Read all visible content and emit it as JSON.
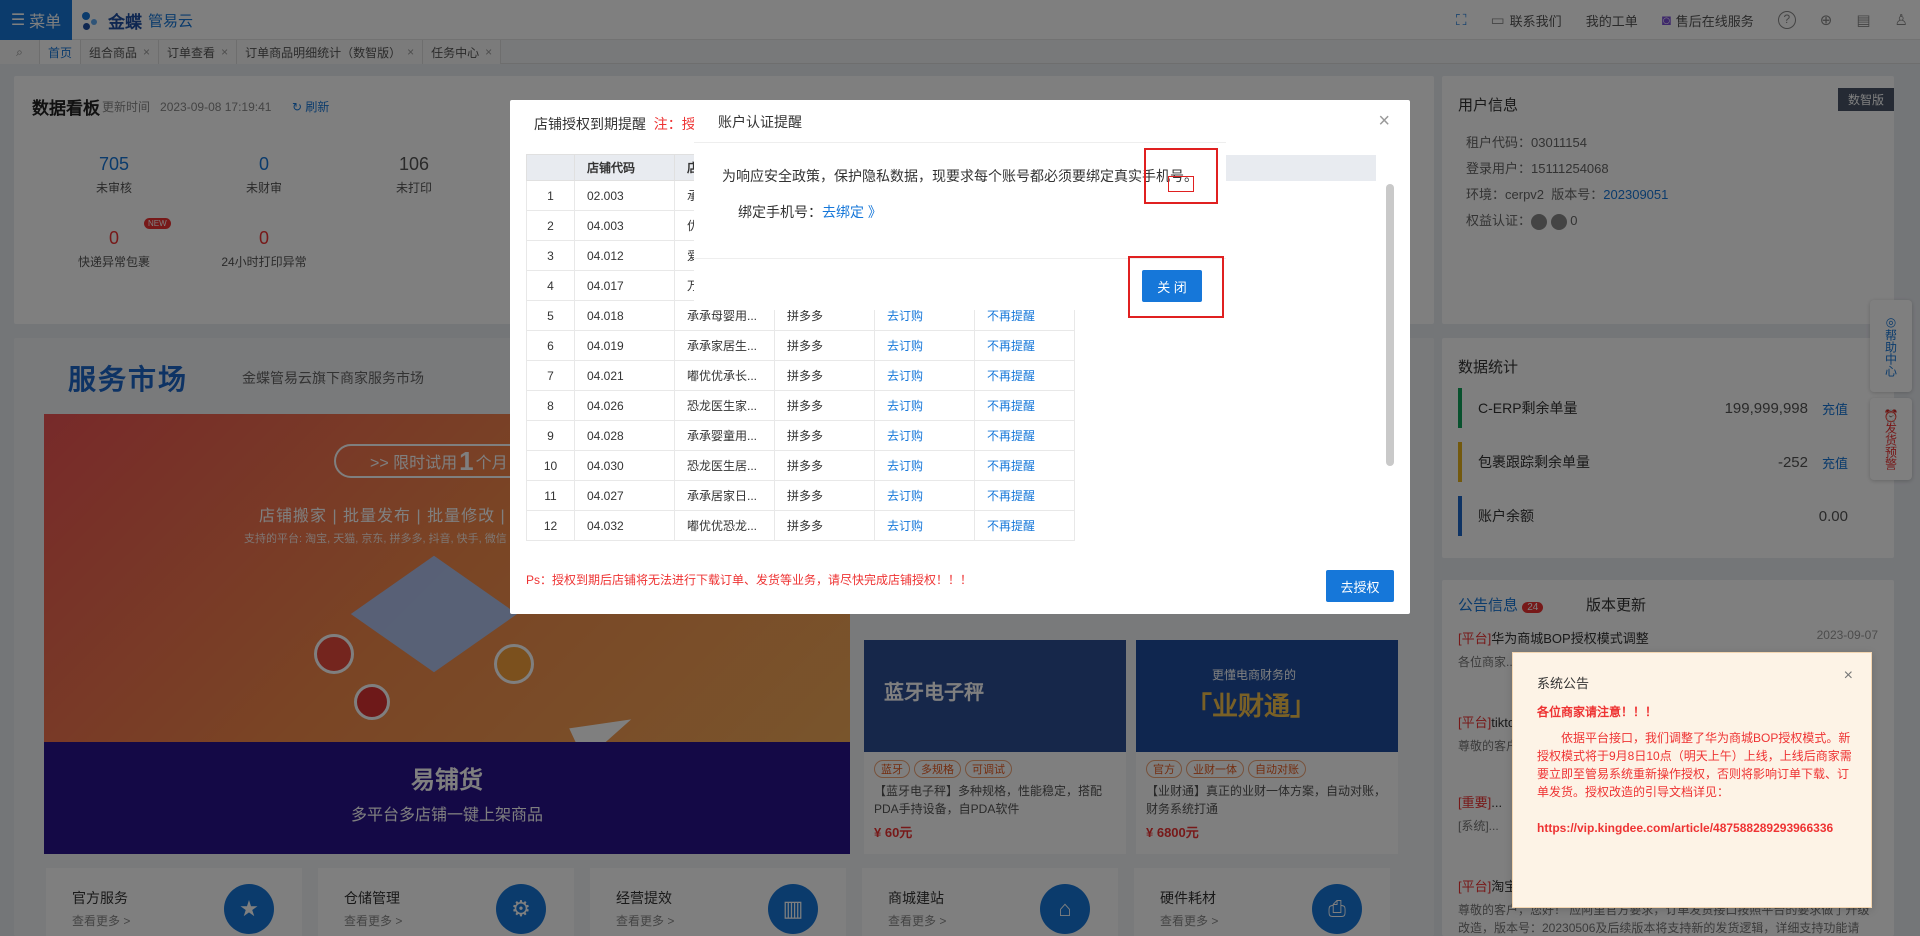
{
  "topbar": {
    "menu_label": "菜单",
    "brand_name": "金蝶",
    "brand_sub": "管易云",
    "links": [
      "联系我们",
      "我的工单",
      "售后在线服务"
    ]
  },
  "tabs": [
    {
      "label": "首页"
    },
    {
      "label": "组合商品"
    },
    {
      "label": "订单查看"
    },
    {
      "label": "订单商品明细统计（数智版）"
    },
    {
      "label": "任务中心"
    }
  ],
  "dashboard": {
    "title": "数据看板",
    "time_label": "更新时间",
    "time_value": "2023-09-08 17:19:41",
    "refresh": "刷新",
    "stats": [
      {
        "value": "705",
        "label": "未审核"
      },
      {
        "value": "0",
        "label": "未财审"
      },
      {
        "value": "106",
        "label": "未打印"
      },
      {
        "value": "0",
        "label": "快递异常包裹"
      },
      {
        "value": "0",
        "label": "24小时打印异常"
      }
    ],
    "new_tag": "NEW"
  },
  "service_market": {
    "title": "服务市场",
    "subtitle": "金蝶管易云旗下商家服务市场",
    "banner": {
      "pill": ">> 限时试用",
      "pill_big": "1",
      "pill_tail": "个月",
      "line": "店铺搬家 | 批量发布 | 批量修改 |",
      "small": "支持的平台: 淘宝, 天猫, 京东, 拼多多, 抖音, 快手, 微信",
      "title": "易铺货",
      "subtitle": "多平台多店铺一键上架商品"
    }
  },
  "products": [
    {
      "label": "蓝牙电子秤",
      "tags": [
        "蓝牙",
        "多规格",
        "可调试"
      ],
      "desc": "【蓝牙电子秤】多种规格，性能稳定，搭配PDA手持设备，自PDA软件",
      "price": "¥ 60元"
    },
    {
      "label": "「业财通」",
      "top_label": "更懂电商财务的",
      "tags": [
        "官方",
        "业财一体",
        "自动对账"
      ],
      "desc": "【业财通】真正的业财一体方案，自动对账，财务系统打通",
      "price": "¥ 6800元"
    }
  ],
  "categories": [
    {
      "title": "官方服务",
      "more": "查看更多 >",
      "icon": "star-icon"
    },
    {
      "title": "仓储管理",
      "more": "查看更多 >",
      "icon": "gear-icon"
    },
    {
      "title": "经营提效",
      "more": "查看更多 >",
      "icon": "chart-icon"
    },
    {
      "title": "商城建站",
      "more": "查看更多 >",
      "icon": "store-icon"
    },
    {
      "title": "硬件耗材",
      "more": "查看更多 >",
      "icon": "printer-icon"
    }
  ],
  "user_info": {
    "title": "用户信息",
    "badge": "数智版",
    "tenant_label": "租户代码：",
    "tenant": "03011154",
    "login_label": "登录用户：",
    "login": "15111254068",
    "env_label": "环境：",
    "env": "cerpv2",
    "version_label": "版本号：",
    "version": "202309051",
    "rights_label": "权益认证：",
    "rights_value": "0"
  },
  "data_stats": {
    "title": "数据统计",
    "rows": [
      {
        "label": "C-ERP剩余单量",
        "value": "199,999,998",
        "action": "充值",
        "color": "#10a35b"
      },
      {
        "label": "包裹跟踪剩余单量",
        "value": "-252",
        "action": "充值",
        "color": "#e6b31b"
      },
      {
        "label": "账户余额",
        "value": "0.00",
        "action": "",
        "color": "#1c66c8"
      }
    ]
  },
  "notices": {
    "tab1": "公告信息",
    "tab1_count": "24",
    "tab2": "版本更新",
    "items": [
      {
        "tag": "[平台]",
        "title": "华为商城BOP授权模式调整",
        "date": "2023-09-07",
        "body": "各位商家..."
      },
      {
        "tag": "[平台]",
        "title": "tiktok...",
        "date": "",
        "body": "尊敬的客户..."
      },
      {
        "tag": "[重要]",
        "title": "...",
        "date": "",
        "body": "[系统]..."
      },
      {
        "tag": "[平台]",
        "title": "淘宝...",
        "date": "",
        "body": "尊敬的客户，您好！ 应阿里官方要求，订单发货接口按照平台的要求做了升级改造，版本号：20230506及后续版本将支持新的发货逻辑，详细支持功能请咨..."
      }
    ]
  },
  "float_help": "帮助中心",
  "float_alert": "发货预警",
  "shop_dialog": {
    "title": "店铺授权到期提醒",
    "warn": "注：授...",
    "columns": [
      "",
      "店铺代码",
      "店",
      "",
      "",
      ""
    ],
    "rows": [
      {
        "idx": "1",
        "code": "02.003",
        "name": "承...",
        "platform": "",
        "action": "",
        "skip": ""
      },
      {
        "idx": "2",
        "code": "04.003",
        "name": "优...",
        "platform": "",
        "action": "",
        "skip": ""
      },
      {
        "idx": "3",
        "code": "04.012",
        "name": "爱...",
        "platform": "",
        "action": "",
        "skip": ""
      },
      {
        "idx": "4",
        "code": "04.017",
        "name": "万...",
        "platform": "",
        "action": "",
        "skip": ""
      },
      {
        "idx": "5",
        "code": "04.018",
        "name": "承承母婴用...",
        "platform": "拼多多",
        "action": "去订购",
        "skip": "不再提醒"
      },
      {
        "idx": "6",
        "code": "04.019",
        "name": "承承家居生...",
        "platform": "拼多多",
        "action": "去订购",
        "skip": "不再提醒"
      },
      {
        "idx": "7",
        "code": "04.021",
        "name": "嘟优优承长...",
        "platform": "拼多多",
        "action": "去订购",
        "skip": "不再提醒"
      },
      {
        "idx": "8",
        "code": "04.026",
        "name": "恐龙医生家...",
        "platform": "拼多多",
        "action": "去订购",
        "skip": "不再提醒"
      },
      {
        "idx": "9",
        "code": "04.028",
        "name": "承承婴童用...",
        "platform": "拼多多",
        "action": "去订购",
        "skip": "不再提醒"
      },
      {
        "idx": "10",
        "code": "04.030",
        "name": "恐龙医生居...",
        "platform": "拼多多",
        "action": "去订购",
        "skip": "不再提醒"
      },
      {
        "idx": "11",
        "code": "04.027",
        "name": "承承居家日...",
        "platform": "拼多多",
        "action": "去订购",
        "skip": "不再提醒"
      },
      {
        "idx": "12",
        "code": "04.032",
        "name": "嘟优优恐龙...",
        "platform": "拼多多",
        "action": "去订购",
        "skip": "不再提醒"
      }
    ],
    "footer": "Ps：授权到期后店铺将无法进行下载订单、发货等业务，请尽快完成店铺授权！！！",
    "button": "去授权"
  },
  "auth_dialog": {
    "title": "账户认证提醒",
    "message": "为响应安全政策，保护隐私数据，现要求每个账号都必须要绑定真实手机号。",
    "bind_label": "绑定手机号：",
    "bind_link": "去绑定 》",
    "close": "关 闭"
  },
  "system_notice": {
    "title": "系统公告",
    "subtitle": "各位商家请注意！！！",
    "body": "依据平台接口，我们调整了华为商城BOP授权模式。新授权模式将于9月8日10点（明天上午）上线，上线后商家需要立即至管易系统重新操作授权，否则将影响订单下载、订单发货。授权改造的引导文档详见：",
    "url": "https://vip.kingdee.com/article/487588289293966336"
  }
}
